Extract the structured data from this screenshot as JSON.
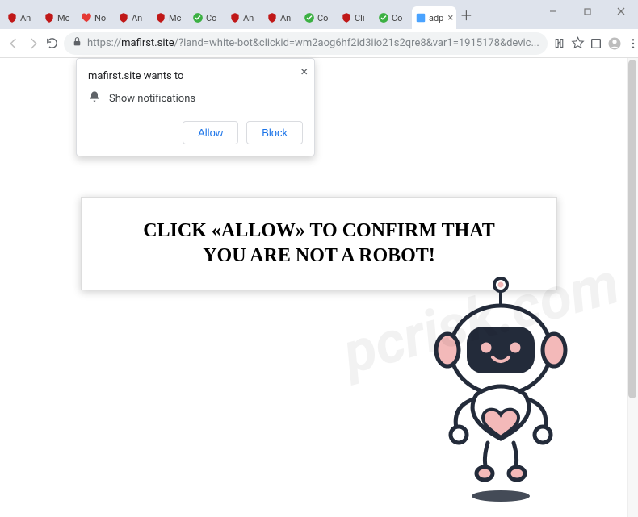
{
  "window": {
    "tabs": [
      {
        "icon": "mcafee",
        "label": "An"
      },
      {
        "icon": "mcafee",
        "label": "Mc"
      },
      {
        "icon": "heart",
        "label": "No"
      },
      {
        "icon": "mcafee",
        "label": "An"
      },
      {
        "icon": "mcafee",
        "label": "Mc"
      },
      {
        "icon": "check",
        "label": "Co"
      },
      {
        "icon": "mcafee",
        "label": "An"
      },
      {
        "icon": "mcafee",
        "label": "An"
      },
      {
        "icon": "check",
        "label": "Co"
      },
      {
        "icon": "mcafee",
        "label": "Cli"
      },
      {
        "icon": "check",
        "label": "Co"
      },
      {
        "icon": "page",
        "label": "adp",
        "active": true,
        "closeable": true
      }
    ]
  },
  "address": {
    "scheme": "https://",
    "host": "mafirst.site",
    "path": "/?land=white-bot&clickid=wm2aog6hf2id3iio21s2qre8&var1=1915178&devic..."
  },
  "prompt": {
    "title": "mafirst.site wants to",
    "text": "Show notifications",
    "allow": "Allow",
    "block": "Block"
  },
  "page": {
    "message_line1": "CLICK «ALLOW» TO CONFIRM THAT",
    "message_line2": "YOU ARE NOT A ROBOT!"
  },
  "watermark": "pcrisk.com"
}
